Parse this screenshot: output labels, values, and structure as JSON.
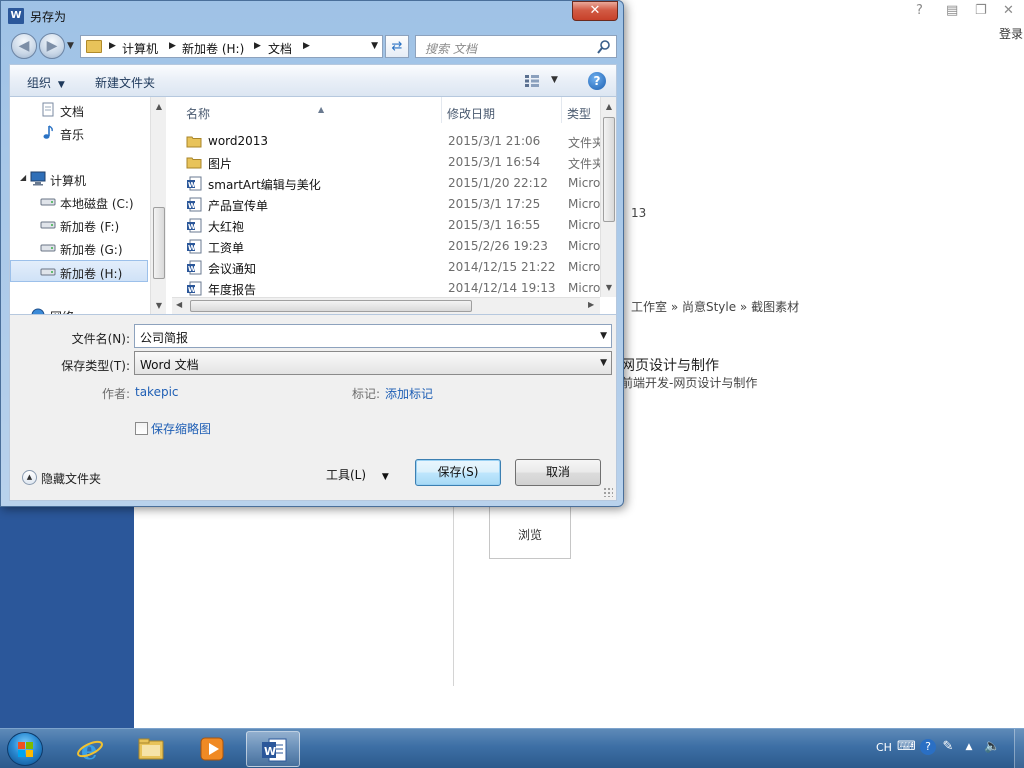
{
  "window_title": "另存为",
  "navigation": {
    "breadcrumbs": [
      "计算机",
      "新加卷 (H:)",
      "文档"
    ],
    "search_placeholder": "搜索 文档"
  },
  "toolbar": {
    "organize": "组织",
    "new_folder": "新建文件夹"
  },
  "nav_pane": {
    "items": [
      {
        "label": "文档",
        "icon": "documents-icon"
      },
      {
        "label": "音乐",
        "icon": "music-icon"
      },
      {
        "label": "计算机",
        "icon": "computer-icon"
      },
      {
        "label": "本地磁盘 (C:)",
        "icon": "drive-icon"
      },
      {
        "label": "新加卷 (F:)",
        "icon": "drive-icon"
      },
      {
        "label": "新加卷 (G:)",
        "icon": "drive-icon"
      },
      {
        "label": "新加卷 (H:)",
        "icon": "drive-icon",
        "selected": true
      },
      {
        "label": "网络",
        "icon": "network-icon"
      }
    ]
  },
  "file_list": {
    "columns": [
      "名称",
      "修改日期",
      "类型"
    ],
    "rows": [
      {
        "name": "word2013",
        "date": "2015/3/1 21:06",
        "type": "文件夹",
        "icon": "folder-icon"
      },
      {
        "name": "图片",
        "date": "2015/3/1 16:54",
        "type": "文件夹",
        "icon": "folder-icon"
      },
      {
        "name": "smartArt编辑与美化",
        "date": "2015/1/20 22:12",
        "type": "Microsoft",
        "icon": "word-doc-icon"
      },
      {
        "name": "产品宣传单",
        "date": "2015/3/1 17:25",
        "type": "Microsoft",
        "icon": "word-doc-icon"
      },
      {
        "name": "大红袍",
        "date": "2015/3/1 16:55",
        "type": "Microsoft",
        "icon": "word-doc-icon"
      },
      {
        "name": "工资单",
        "date": "2015/2/26 19:23",
        "type": "Microsoft",
        "icon": "word-doc-icon"
      },
      {
        "name": "会议通知",
        "date": "2014/12/15 21:22",
        "type": "Microsoft",
        "icon": "word-doc-icon"
      },
      {
        "name": "年度报告",
        "date": "2014/12/14 19:13",
        "type": "Microsoft",
        "icon": "word-doc-icon"
      }
    ]
  },
  "form": {
    "filename_label": "文件名(N):",
    "filename_value": "公司简报",
    "filetype_label": "保存类型(T):",
    "filetype_value": "Word 文档",
    "author_label": "作者:",
    "author_value": "takepic",
    "tags_label": "标记:",
    "tags_value": "添加标记",
    "thumbnail_label": "保存缩略图",
    "hide_folders": "隐藏文件夹",
    "tools": "工具(L)",
    "save": "保存(S)",
    "cancel": "取消"
  },
  "background": {
    "help": "?",
    "login": "登录",
    "partial_year": "13",
    "path": "工作室 » 尚意Style » 截图素材",
    "recent_title": "网页设计与制作",
    "recent_sub": "前端开发-网页设计与制作",
    "browse": "浏览"
  },
  "taskbar": {
    "lang": "CH"
  },
  "colors": {
    "word_blue": "#2b579a",
    "link_blue": "#1f5fb5",
    "close_red": "#c7412a"
  }
}
